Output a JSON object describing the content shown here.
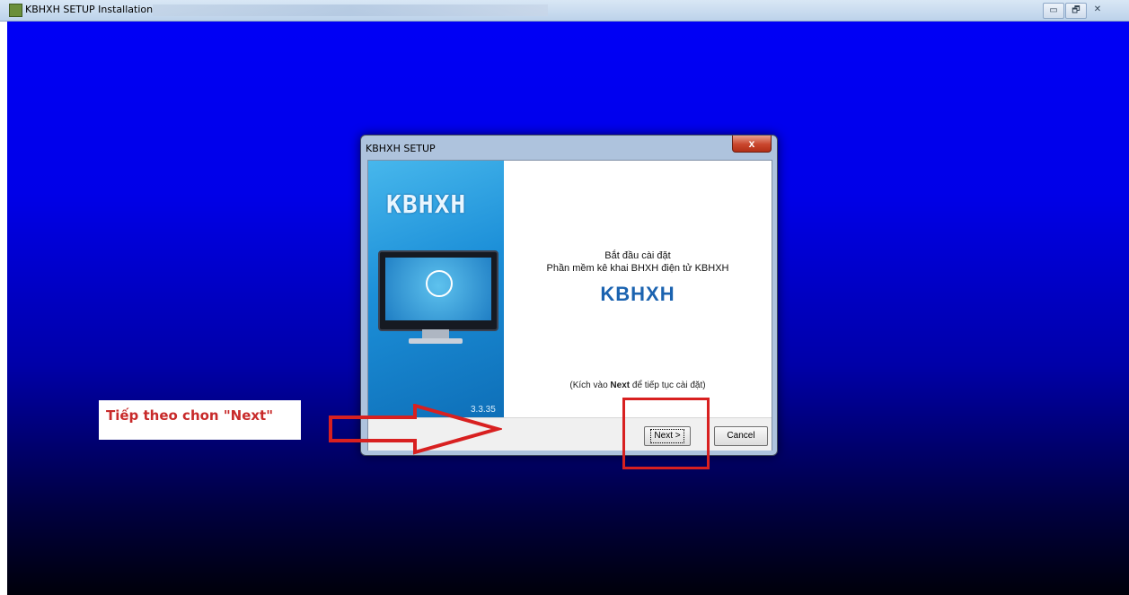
{
  "window": {
    "title": "KBHXH SETUP Installation",
    "controls": [
      "▭",
      "🗗",
      "✕"
    ]
  },
  "dialog": {
    "title": "KBHXH SETUP",
    "close_label": "x",
    "side_logo": "KBHXH",
    "side_version": "3.3.35",
    "welcome_line1": "Bắt đầu cài đặt",
    "welcome_line2": "Phần mềm kê khai BHXH điện tử KBHXH",
    "main_logo": "KBHXH",
    "hint_prefix": "(Kích vào ",
    "hint_bold": "Next",
    "hint_suffix": " để tiếp tục cài đặt)",
    "next_label": "Next >",
    "cancel_label": "Cancel"
  },
  "annotation": {
    "label": "Tiếp theo chon \"Next\"",
    "color": "#d82020"
  },
  "colors": {
    "background_top": "#0000f6",
    "background_bottom": "#00000a",
    "side_panel": "#1c8fd8"
  }
}
